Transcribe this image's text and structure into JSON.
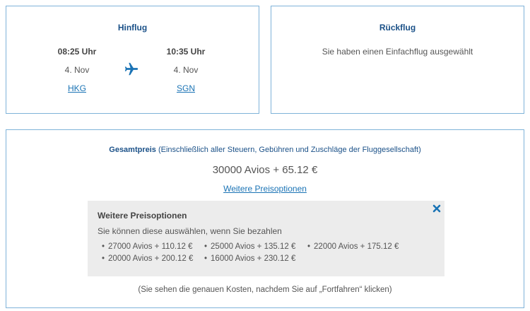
{
  "outbound": {
    "title": "Hinflug",
    "departure": {
      "time": "08:25 Uhr",
      "date": "4. Nov",
      "airport": "HKG"
    },
    "arrival": {
      "time": "10:35 Uhr",
      "date": "4. Nov",
      "airport": "SGN"
    },
    "icon": "airplane-icon"
  },
  "inbound": {
    "title": "Rückflug",
    "message": "Sie haben einen Einfachflug ausgewählt"
  },
  "price": {
    "total_label": "Gesamtpreis",
    "total_note": "(Einschließlich aller Steuern, Gebühren und Zuschläge der Fluggesellschaft)",
    "amount": "30000 Avios + 65.12 €",
    "more_options_link": "Weitere Preisoptionen",
    "options_panel": {
      "title": "Weitere Preisoptionen",
      "subtitle": "Sie können diese auswählen, wenn Sie bezahlen",
      "close_icon": "close-icon",
      "items": [
        "27000 Avios + 110.12 €",
        "25000 Avios + 135.12 €",
        "22000 Avios + 175.12 €",
        "20000 Avios + 200.12 €",
        "16000 Avios + 230.12 €"
      ]
    },
    "footer_note": "(Sie sehen die genauen Kosten, nachdem Sie auf „Fortfahren“ klicken)"
  },
  "colors": {
    "accent": "#1a73b5",
    "title": "#1b5188",
    "border": "#7fb3d9",
    "panel_bg": "#ececec"
  }
}
